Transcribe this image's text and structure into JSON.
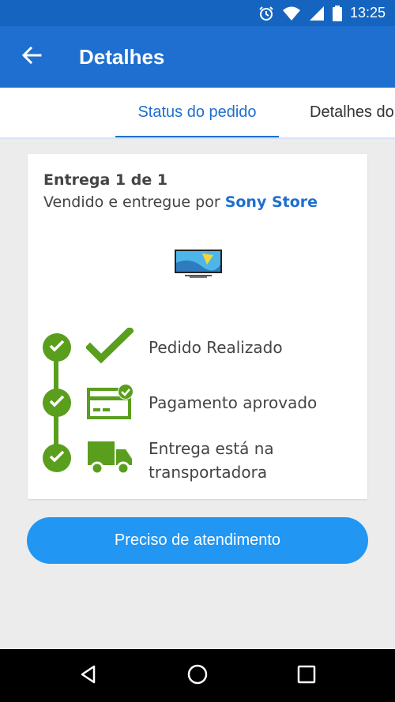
{
  "status_bar": {
    "time": "13:25"
  },
  "appbar": {
    "title": "Detalhes"
  },
  "tabs": [
    {
      "label": "Status do pedido"
    },
    {
      "label": "Detalhes do"
    }
  ],
  "card": {
    "delivery_title": "Entrega 1 de 1",
    "seller_prefix": "Vendido e entregue por",
    "seller_name": "Sony Store",
    "steps": [
      {
        "label": "Pedido Realizado",
        "icon": "checkmark-icon"
      },
      {
        "label": "Pagamento aprovado",
        "icon": "payment-card-icon"
      },
      {
        "label_line1": "Entrega está na",
        "label_line2": "transportadora",
        "icon": "delivery-truck-icon"
      }
    ]
  },
  "help_button": {
    "label": "Preciso de atendimento"
  },
  "colors": {
    "primary": "#1e6fd0",
    "accent_button": "#2196f3",
    "success": "#5a9e1d"
  }
}
